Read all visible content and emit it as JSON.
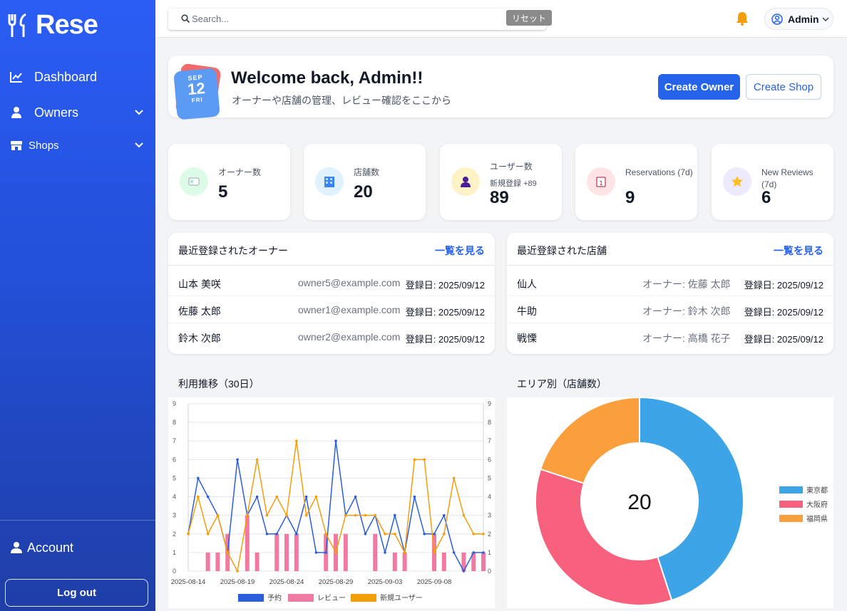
{
  "sidebar": {
    "brand": "Rese",
    "nav": {
      "dashboard": "Dashboard",
      "owners": "Owners",
      "shops": "Shops",
      "account": "Account"
    },
    "logout": "Log out"
  },
  "topbar": {
    "search_placeholder": "Search...",
    "reset": "リセット",
    "user": "Admin"
  },
  "welcome": {
    "cal_month": "SEP",
    "cal_day": "12",
    "cal_weekday": "FRI",
    "title": "Welcome back, Admin!!",
    "subtitle": "オーナーや店舗の管理、レビュー確認をここから",
    "create_owner": "Create Owner",
    "create_shop": "Create Shop"
  },
  "stats": [
    {
      "label": "オーナー数",
      "value": "5",
      "sub": "",
      "icon": "id-card-icon",
      "bg": "#dcfce7"
    },
    {
      "label": "店舗数",
      "value": "20",
      "sub": "",
      "icon": "building-icon",
      "bg": "#e0f2fe"
    },
    {
      "label": "ユーザー数",
      "value": "89",
      "sub": "新規登録 +89",
      "icon": "user-icon",
      "bg": "#fef3c7"
    },
    {
      "label": "Reservations (7d)",
      "value": "9",
      "sub": "",
      "icon": "calendar-icon",
      "bg": "#ffe4e6"
    },
    {
      "label": "New Reviews (7d)",
      "value": "6",
      "sub": "",
      "icon": "star-icon",
      "bg": "#ede9fe"
    }
  ],
  "owners_list": {
    "title": "最近登録されたオーナー",
    "link": "一覧を見る",
    "rows": [
      {
        "name": "山本 美咲",
        "email": "owner5@example.com",
        "date": "登録日: 2025/09/12"
      },
      {
        "name": "佐藤 太郎",
        "email": "owner1@example.com",
        "date": "登録日: 2025/09/12"
      },
      {
        "name": "鈴木 次郎",
        "email": "owner2@example.com",
        "date": "登録日: 2025/09/12"
      }
    ]
  },
  "shops_list": {
    "title": "最近登録された店舗",
    "link": "一覧を見る",
    "rows": [
      {
        "name": "仙人",
        "owner": "オーナー: 佐藤 太郎",
        "date": "登録日: 2025/09/12"
      },
      {
        "name": "牛助",
        "owner": "オーナー: 鈴木 次郎",
        "date": "登録日: 2025/09/12"
      },
      {
        "name": "戦慄",
        "owner": "オーナー: 高橋 花子",
        "date": "登録日: 2025/09/12"
      }
    ]
  },
  "chart_titles": {
    "usage": "利用推移（30日）",
    "area": "エリア別（店舗数）"
  },
  "chart_data": [
    {
      "type": "line",
      "x_ticks": [
        "2025-08-14",
        "2025-08-19",
        "2025-08-24",
        "2025-08-29",
        "2025-09-03",
        "2025-09-08"
      ],
      "x_tick_indices": [
        0,
        5,
        10,
        15,
        20,
        25
      ],
      "ylim": [
        0,
        9
      ],
      "y_ticks": [
        0,
        1,
        2,
        3,
        4,
        5,
        6,
        7,
        8,
        9
      ],
      "legend_position": "bottom",
      "series": [
        {
          "name": "予約",
          "kind": "line",
          "color": "#2b5fd9",
          "values": [
            2,
            5,
            4,
            3,
            1,
            6,
            3,
            4,
            2,
            2,
            3,
            2,
            4,
            1,
            1,
            7,
            3,
            4,
            2,
            3,
            1,
            3,
            1,
            4,
            2,
            2,
            3,
            1,
            0,
            1,
            1
          ]
        },
        {
          "name": "レビュー",
          "kind": "bar",
          "color": "#f07aa0",
          "values": [
            0,
            0,
            1,
            1,
            2,
            0,
            3,
            1,
            0,
            2,
            2,
            2,
            0,
            0,
            2,
            2,
            2,
            0,
            0,
            2,
            0,
            1,
            1,
            0,
            0,
            2,
            1,
            0,
            1,
            1,
            1
          ]
        },
        {
          "name": "新規ユーザー",
          "kind": "line",
          "color": "#f59e0b",
          "values": [
            2,
            4,
            2,
            3,
            1,
            0,
            3,
            6,
            3,
            4,
            3,
            7,
            3,
            4,
            2,
            1,
            3,
            3,
            3,
            3,
            2,
            2,
            1,
            6,
            6,
            1,
            2,
            5,
            3,
            2,
            2
          ]
        }
      ]
    },
    {
      "type": "pie",
      "variant": "doughnut",
      "center_label": "20",
      "categories": [
        "東京都",
        "大阪府",
        "福岡県"
      ],
      "values": [
        9,
        7,
        4
      ],
      "colors": [
        "#3ea4e8",
        "#f8617e",
        "#fb9f3c"
      ],
      "legend_position": "right"
    }
  ]
}
